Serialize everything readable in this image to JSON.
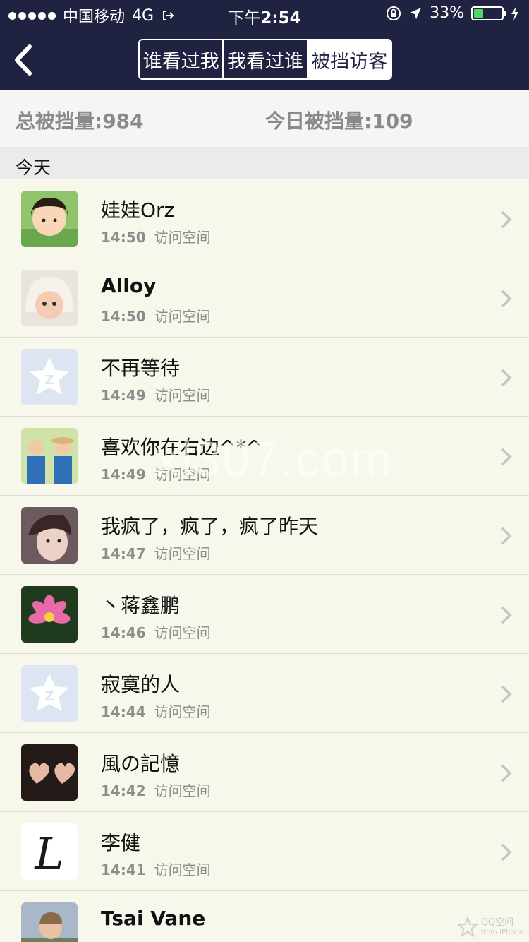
{
  "status_bar": {
    "carrier": "中国移动",
    "network": "4G",
    "time_prefix": "下午",
    "time": "2:54",
    "battery": "33%",
    "battery_level": 0.33
  },
  "nav": {
    "tabs": [
      {
        "label": "谁看过我",
        "active": false
      },
      {
        "label": "我看过谁",
        "active": false
      },
      {
        "label": "被挡访客",
        "active": true
      }
    ]
  },
  "stats": {
    "total": "总被挡量:984",
    "today": "今日被挡量:109"
  },
  "section_title": "今天",
  "visitors": [
    {
      "name": "娃娃Orz",
      "time": "14:50",
      "action": "访问空间"
    },
    {
      "name": "Alloy",
      "time": "14:50",
      "action": "访问空间"
    },
    {
      "name": "不再等待",
      "time": "14:49",
      "action": "访问空间"
    },
    {
      "name": " 喜欢你在右边^*^",
      "time": "14:49",
      "action": "访问空间"
    },
    {
      "name": "我疯了，疯了，疯了昨天",
      "time": "14:47",
      "action": "访问空间"
    },
    {
      "name": "丶蒋鑫鹏",
      "time": "14:46",
      "action": "访问空间"
    },
    {
      "name": "寂寞的人",
      "time": "14:44",
      "action": "访问空间"
    },
    {
      "name": "風の記憶",
      "time": "14:42",
      "action": "访问空间"
    },
    {
      "name": "李健",
      "time": "14:41",
      "action": "访问空间"
    },
    {
      "name": "Tsai Vane",
      "time": "",
      "action": ""
    }
  ],
  "watermark": "xl307.com",
  "badge": {
    "title": "QQ空间",
    "sub": "from iPhone"
  },
  "colors": {
    "nav_bg": "#1f2240",
    "list_bg": "#f8f7ec",
    "battery": "#4cd964"
  }
}
